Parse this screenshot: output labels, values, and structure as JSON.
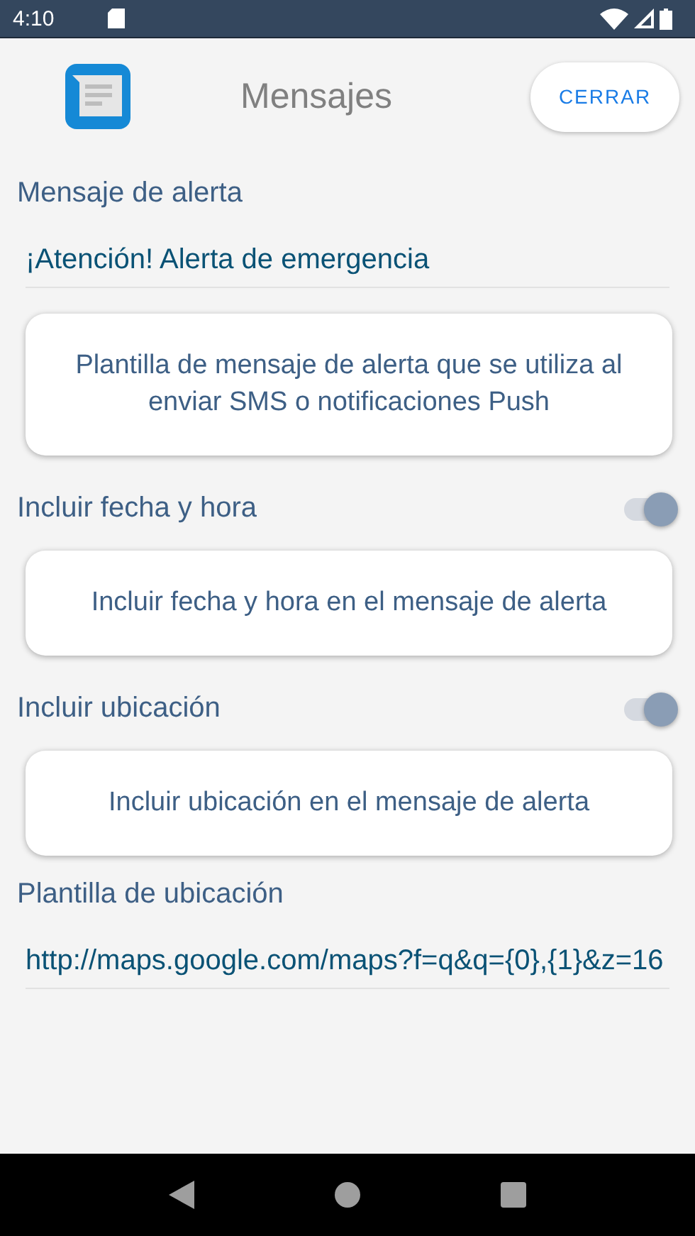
{
  "status_bar": {
    "time": "4:10"
  },
  "header": {
    "title": "Mensajes",
    "close_button": "CERRAR"
  },
  "sections": [
    {
      "kind": "field",
      "label": "Mensaje de alerta",
      "value": "¡Atención! Alerta de emergencia"
    },
    {
      "kind": "note",
      "text": "Plantilla de mensaje de alerta que se utiliza al enviar SMS o notificaciones Push"
    },
    {
      "kind": "toggle",
      "label": "Incluir fecha y hora",
      "on": true
    },
    {
      "kind": "note",
      "text": "Incluir fecha y hora en el mensaje de alerta"
    },
    {
      "kind": "toggle",
      "label": "Incluir ubicación",
      "on": true
    },
    {
      "kind": "note",
      "text": "Incluir ubicación en el mensaje de alerta"
    },
    {
      "kind": "field",
      "label": "Plantilla de ubicación",
      "value": "http://maps.google.com/maps?f=q&q={0},{1}&z=16"
    }
  ]
}
